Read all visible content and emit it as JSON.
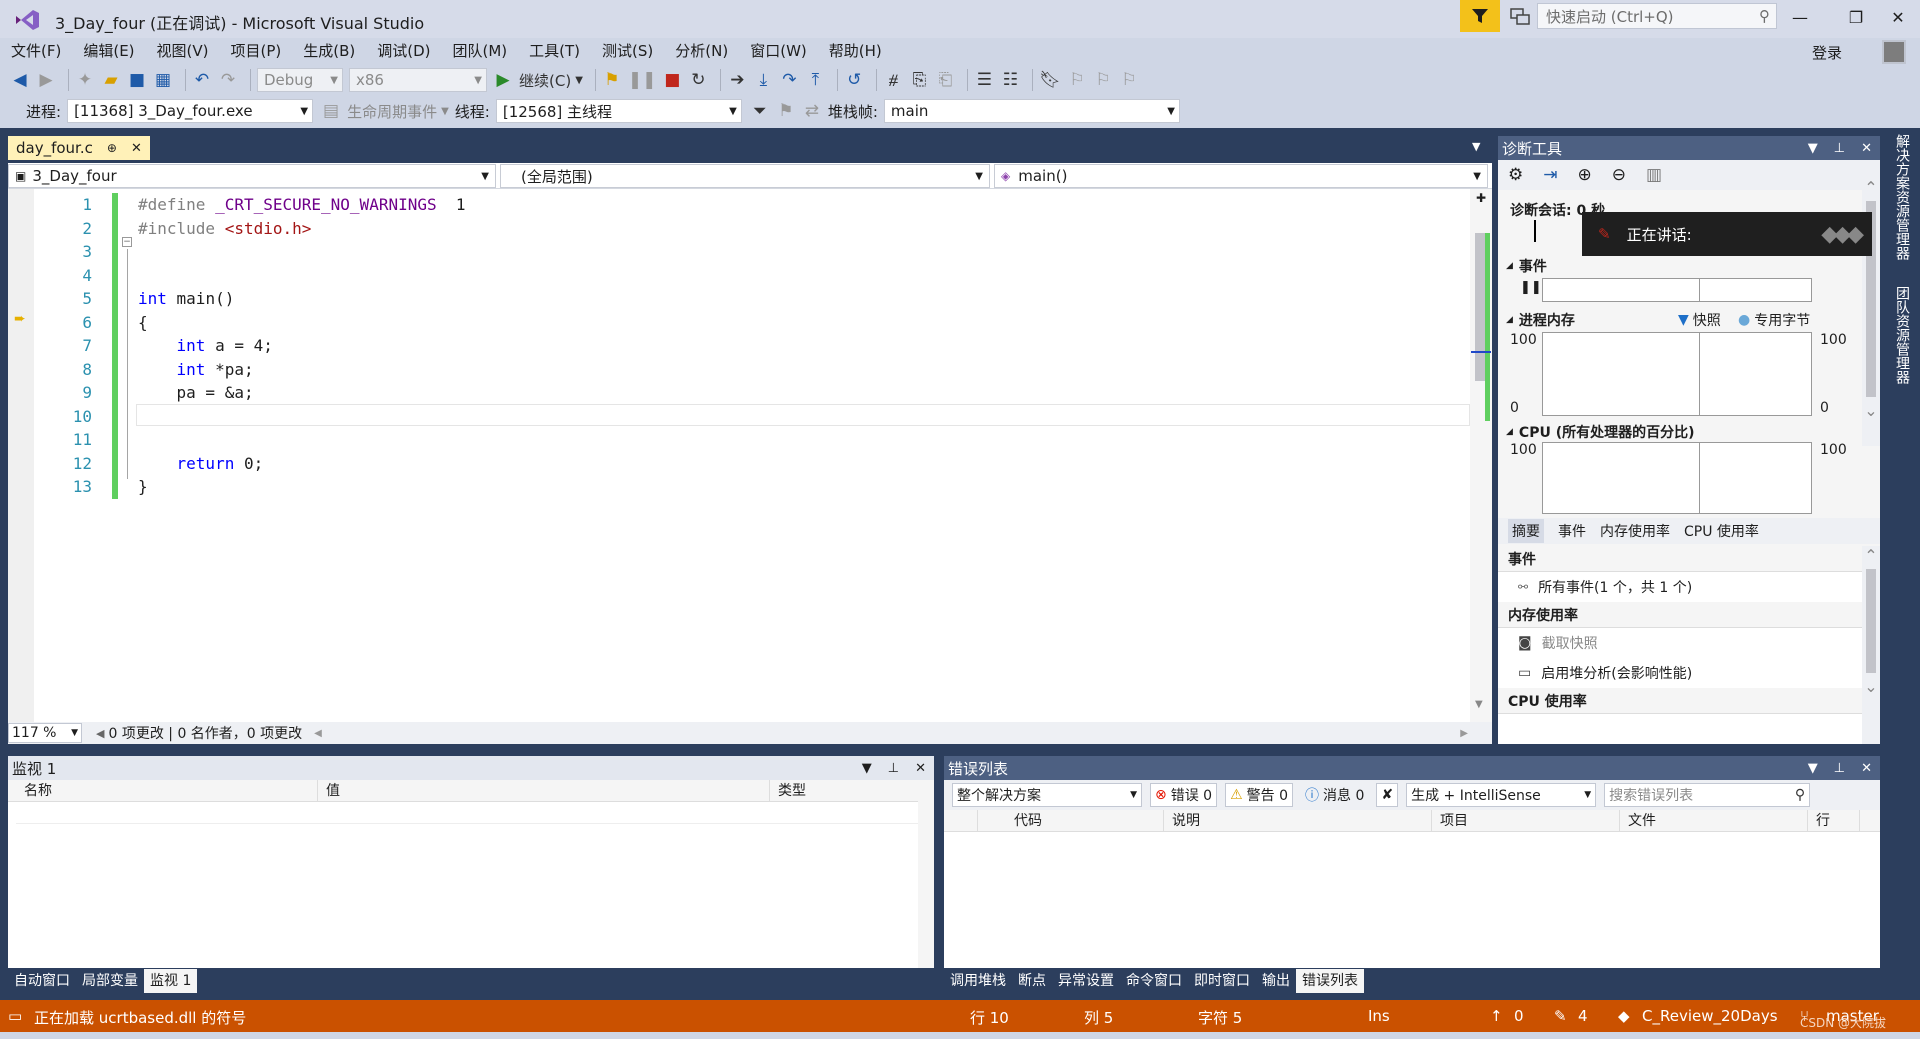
{
  "window": {
    "title": "3_Day_four (正在调试) - Microsoft Visual Studio",
    "quick_launch_placeholder": "快速启动 (Ctrl+Q)",
    "minimize": "—",
    "maximize": "❐",
    "close": "✕",
    "signin": "登录"
  },
  "menu": [
    "文件(F)",
    "编辑(E)",
    "视图(V)",
    "项目(P)",
    "生成(B)",
    "调试(D)",
    "团队(M)",
    "工具(T)",
    "测试(S)",
    "分析(N)",
    "窗口(W)",
    "帮助(H)"
  ],
  "toolbar": {
    "config": "Debug",
    "platform": "x86",
    "continue_label": "继续(C)"
  },
  "debug_location": {
    "process_label": "进程:",
    "process_value": "[11368] 3_Day_four.exe",
    "lifecycle_label": "生命周期事件",
    "thread_label": "线程:",
    "thread_value": "[12568] 主线程",
    "stackframe_label": "堆栈帧:",
    "stackframe_value": "main"
  },
  "editor": {
    "tab_name": "day_four.c",
    "pin": "⊕",
    "nav_project": "3_Day_four",
    "nav_scope": "(全局范围)",
    "nav_member": "main()",
    "line_numbers": [
      "1",
      "2",
      "3",
      "4",
      "5",
      "6",
      "7",
      "8",
      "9",
      "10",
      "11",
      "12",
      "13"
    ],
    "zoom": "117 %",
    "codelens": "0 项更改 | 0 名作者，0 项更改"
  },
  "diag": {
    "title": "诊断工具",
    "session": "诊断会话: 0 秒",
    "events_section": "事件",
    "memory_section": "进程内存",
    "snapshot_legend": "快照",
    "private_bytes_legend": "专用字节",
    "cpu_section": "CPU (所有处理器的百分比)",
    "mem_max": "100",
    "mem_min": "0",
    "mem_max_r": "100",
    "mem_min_r": "0",
    "cpu_max": "100",
    "cpu_max_r": "100",
    "tabs": [
      "摘要",
      "事件",
      "内存使用率",
      "CPU 使用率"
    ],
    "summary": {
      "events_header": "事件",
      "all_events": "所有事件(1 个，共 1 个)",
      "memory_header": "内存使用率",
      "take_snapshot": "截取快照",
      "heap_profiling": "启用堆分析(会影响性能)",
      "cpu_header": "CPU 使用率"
    }
  },
  "voice": {
    "label": "正在讲话:"
  },
  "side_tabs": [
    "解决方案资源管理器",
    "团队资源管理器"
  ],
  "watch": {
    "title": "监视 1",
    "columns": [
      "名称",
      "值",
      "类型"
    ],
    "bottom_tabs": [
      "自动窗口",
      "局部变量",
      "监视 1"
    ]
  },
  "errors": {
    "title": "错误列表",
    "scope": "整个解决方案",
    "errors_btn": "错误 0",
    "warnings_btn": "警告 0",
    "messages_btn": "消息 0",
    "build_filter": "生成 + IntelliSense",
    "search_placeholder": "搜索错误列表",
    "columns": [
      "代码",
      "说明",
      "项目",
      "文件",
      "行"
    ],
    "bottom_tabs": [
      "调用堆栈",
      "断点",
      "异常设置",
      "命令窗口",
      "即时窗口",
      "输出",
      "错误列表"
    ]
  },
  "status": {
    "message": "正在加载 ucrtbased.dll 的符号",
    "line": "行 10",
    "col": "列 5",
    "ch": "字符 5",
    "ins": "Ins",
    "up": "0",
    "edits": "4",
    "repo": "C_Review_20Days",
    "branch": "master",
    "watermark": "CSDN @大院拔"
  },
  "colors": {
    "statusbar": "#ca5100",
    "accent": "#2c3e5d",
    "changebar": "#5fcf5f"
  }
}
